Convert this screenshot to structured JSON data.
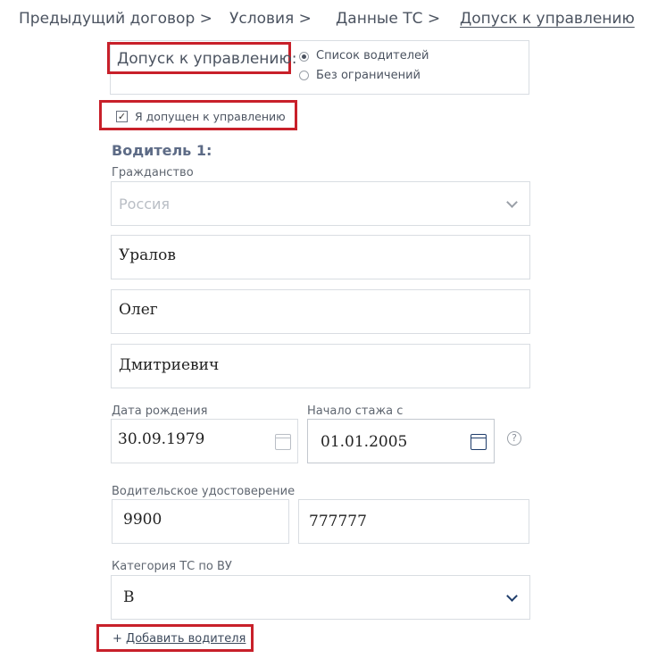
{
  "breadcrumb": {
    "items": [
      "Предыдущий договор >",
      "Условия >",
      "Данные ТС >",
      "Допуск к управлению"
    ]
  },
  "access": {
    "label": "Допуск к управлению:",
    "options": [
      "Список водителей",
      "Без ограничений"
    ],
    "selected": "Список водителей"
  },
  "self_check": {
    "label": "Я допущен к управлению",
    "checked": true
  },
  "driver": {
    "heading": "Водитель 1:",
    "citizenship_label": "Гражданство",
    "citizenship_value": "Россия",
    "last_name": "Уралов",
    "first_name": "Олег",
    "patronymic": "Дмитриевич",
    "birth_date_label": "Дата рождения",
    "birth_date": "30.09.1979",
    "experience_label": "Начало стажа с",
    "experience_date": "01.01.2005",
    "license_label": "Водительское удостоверение",
    "license_series": "9900",
    "license_number": "777777",
    "category_label": "Категория ТС по ВУ",
    "category_value": "B"
  },
  "add_driver": {
    "plus": "+",
    "label": "Добавить водителя"
  },
  "colors": {
    "highlight": "#c8202a",
    "accent": "#1f3d6b",
    "border": "#d9dde2"
  },
  "icons": [
    "checkmark-icon",
    "chevron-down-icon",
    "calendar-icon",
    "help-icon"
  ]
}
